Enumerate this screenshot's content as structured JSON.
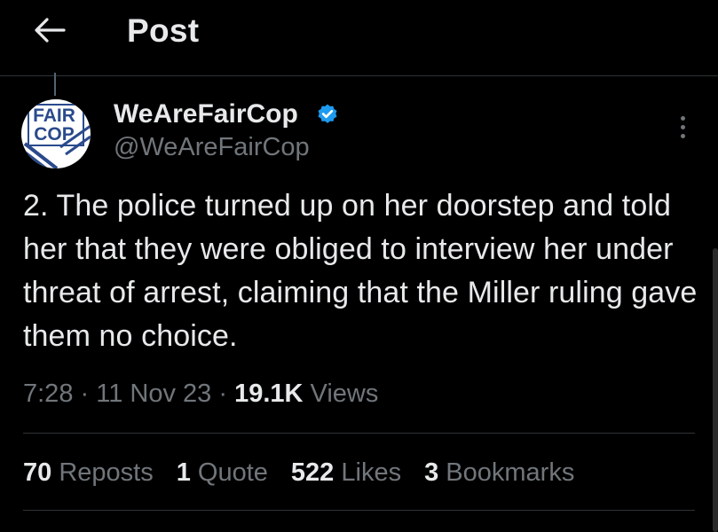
{
  "header": {
    "title": "Post",
    "back_icon": "arrow-left-icon"
  },
  "post": {
    "avatar_text": "FAIR COP",
    "display_name": "WeAreFairCop",
    "verified": true,
    "verified_color": "#1d9bf0",
    "handle": "@WeAreFairCop",
    "text": "2. The police turned up on her doorstep and told her that they were obliged to interview her under threat of arrest, claiming that the Miller ruling gave them no choice.",
    "time": "7:28",
    "date": "11 Nov 23",
    "views_count": "19.1K",
    "views_label": "Views",
    "separator": "·"
  },
  "stats": {
    "reposts_count": "70",
    "reposts_label": "Reposts",
    "quotes_count": "1",
    "quotes_label": "Quote",
    "likes_count": "522",
    "likes_label": "Likes",
    "bookmarks_count": "3",
    "bookmarks_label": "Bookmarks"
  }
}
